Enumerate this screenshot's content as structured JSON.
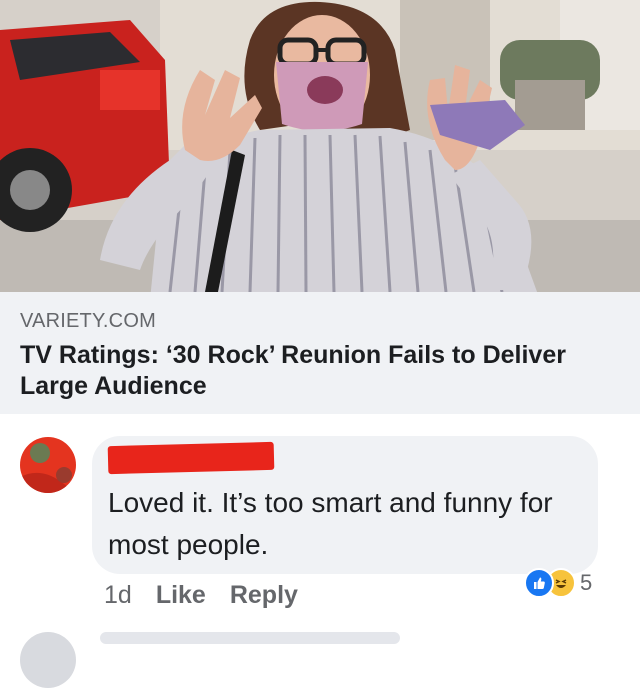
{
  "link_preview": {
    "domain": "VARIETY.COM",
    "headline": "TV Ratings: ‘30 Rock’ Reunion Fails to Deliver Large Audience"
  },
  "comment": {
    "text": "Loved it. It’s too smart and funny for most people.",
    "time": "1d",
    "like_label": "Like",
    "reply_label": "Reply",
    "reaction_icons": [
      "like-icon",
      "haha-icon"
    ],
    "reaction_count": "5"
  },
  "colors": {
    "redaction": "#e8251b",
    "like_blue": "#1877f2",
    "haha_yellow": "#f7c33c",
    "bubble_bg": "#f0f2f5",
    "meta_text": "#65676b"
  }
}
